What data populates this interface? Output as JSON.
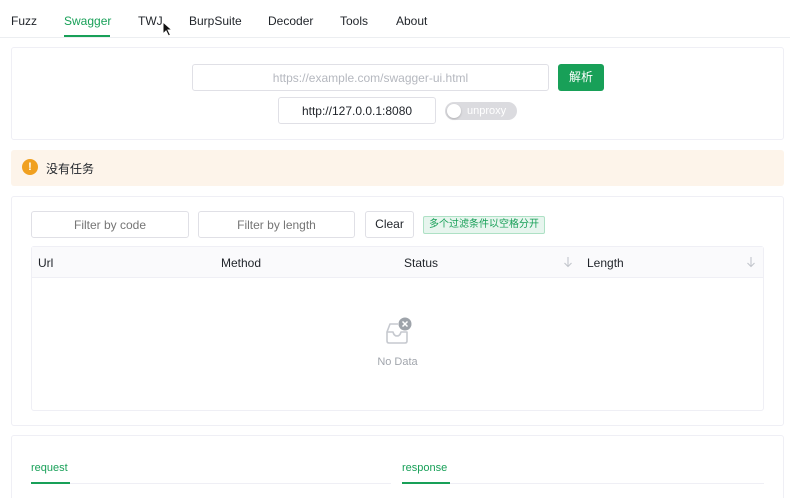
{
  "nav": {
    "tabs": [
      {
        "label": "Fuzz"
      },
      {
        "label": "Swagger"
      },
      {
        "label": "TWJ"
      },
      {
        "label": "BurpSuite"
      },
      {
        "label": "Decoder"
      },
      {
        "label": "Tools"
      },
      {
        "label": "About"
      }
    ],
    "active": "Swagger"
  },
  "swagger": {
    "url_value": "",
    "url_placeholder": "https://example.com/swagger-ui.html",
    "parse_label": "解析",
    "proxy_value": "http://127.0.0.1:8080",
    "proxy_switch_label": "unproxy",
    "proxy_switch_on": false
  },
  "alert": {
    "icon": "exclamation-icon",
    "text": "没有任务"
  },
  "filter": {
    "code_placeholder": "Filter by code",
    "length_placeholder": "Filter by length",
    "clear_label": "Clear",
    "tip": "多个过滤条件以空格分开"
  },
  "table": {
    "columns": [
      {
        "label": "Url"
      },
      {
        "label": "Method"
      },
      {
        "label": "Status"
      },
      {
        "label": "Length"
      }
    ],
    "rows": [],
    "empty_text": "No Data"
  },
  "bottom_tabs": {
    "request": "request",
    "response": "response"
  },
  "colors": {
    "primary": "#18a058",
    "warning": "#f0a020",
    "warning_bg": "#fdf4ea",
    "border": "#efeff5"
  }
}
